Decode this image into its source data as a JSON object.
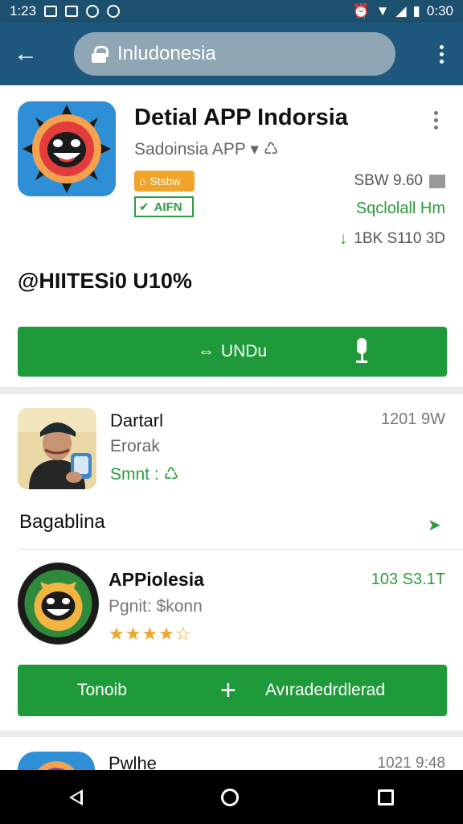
{
  "status_bar": {
    "time": "1:23",
    "battery_time": "0:30"
  },
  "toolbar": {
    "url": "Inludonesia"
  },
  "app": {
    "title": "Detial APP Indorsia",
    "developer": "Sadoinsia APP",
    "badge_orange": "Stsbw",
    "badge_green": "AIFN",
    "meta_size": "SBW 9.60",
    "meta_social": "Sqclolall Hm",
    "meta_downloads": "1BK S110 3D",
    "section_heading": "@HIITESi0 U10%",
    "download_button": "UNDu"
  },
  "review": {
    "name": "Dartarl",
    "subtitle": "Erorak",
    "status": "Smnt :",
    "date": "1201 9W",
    "section_label": "Bagablina"
  },
  "app2": {
    "title": "APPiolesia",
    "subtitle": "Pgnit: $konn",
    "rating": 4.5,
    "meta": "103 S3.1T",
    "button_left": "Tonoib",
    "button_right": "Avıradedrdlerad"
  },
  "app3": {
    "title": "Pwlhe",
    "meta": "1021 9:48"
  },
  "colors": {
    "primary": "#1f587e",
    "green": "#1f9a3a",
    "orange": "#f0a42a"
  }
}
